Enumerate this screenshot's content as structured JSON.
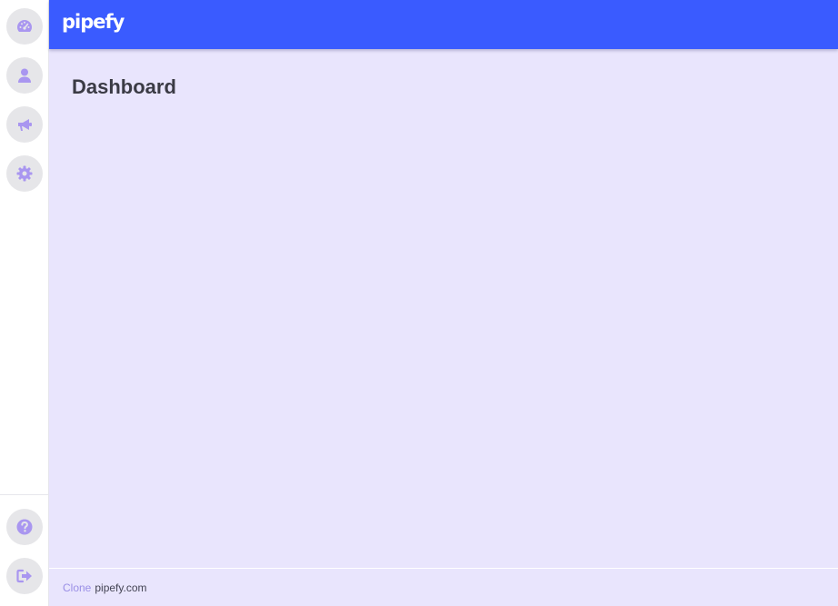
{
  "app": {
    "logo": "pipefy"
  },
  "sidebar": {
    "items": [
      {
        "name": "dashboard",
        "icon": "tachometer-icon"
      },
      {
        "name": "users",
        "icon": "user-icon"
      },
      {
        "name": "announcements",
        "icon": "megaphone-icon"
      },
      {
        "name": "settings",
        "icon": "gear-icon"
      }
    ],
    "bottom_items": [
      {
        "name": "help",
        "icon": "question-circle-icon"
      },
      {
        "name": "logout",
        "icon": "sign-out-icon"
      }
    ],
    "icon_color": "#a996f0",
    "button_bg": "#e6e6e9"
  },
  "topbar": {
    "color": "#3a5bff"
  },
  "main": {
    "title": "Dashboard",
    "background": "#e9e5fd"
  },
  "footer": {
    "clone_label": "Clone",
    "link_text": "pipefy.com"
  }
}
